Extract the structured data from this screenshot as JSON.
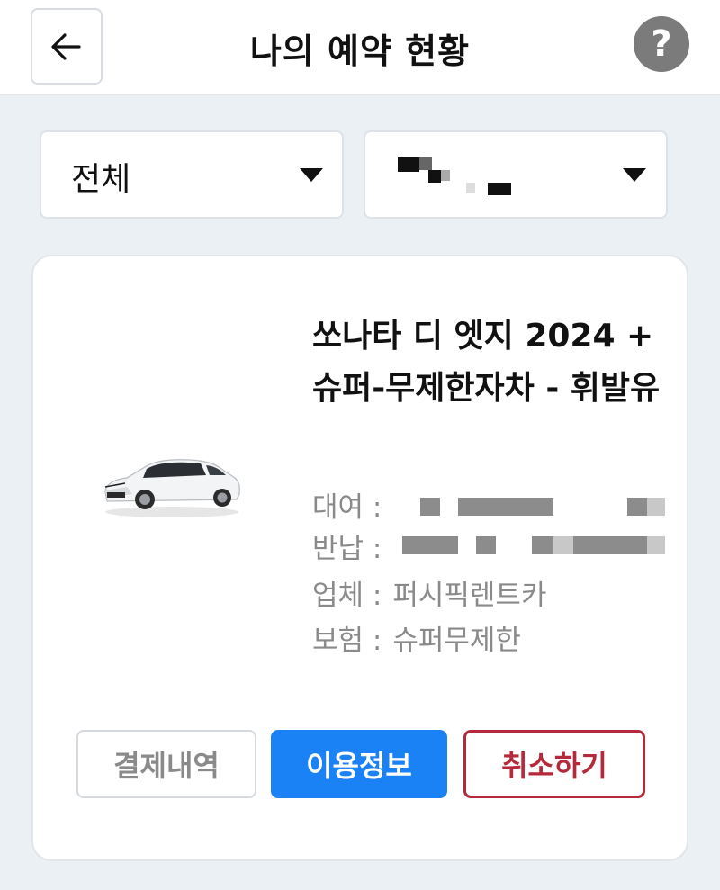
{
  "header": {
    "title": "나의 예약 현황",
    "back_icon": "arrow-left-icon",
    "help_label": "?"
  },
  "filters": {
    "status_label": "전체"
  },
  "reservation": {
    "car_name": "쏘나타 디 엣지 2024 + 슈퍼-무제한자차 - 휘발유",
    "rental_label": "대여 :",
    "return_label": "반납 :",
    "company_label": "업체 :",
    "company_value": "퍼시픽렌트카",
    "insurance_label": "보험 :",
    "insurance_value": "슈퍼무제한"
  },
  "actions": {
    "history_label": "결제내역",
    "info_label": "이용정보",
    "cancel_label": "취소하기"
  },
  "colors": {
    "accent_blue": "#1a82f5",
    "cancel_red": "#b52a3a",
    "background": "#ebf0f5"
  }
}
